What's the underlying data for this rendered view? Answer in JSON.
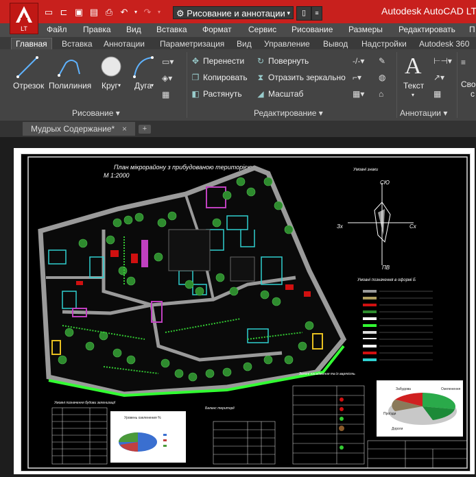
{
  "app": {
    "title": "Autodesk AutoCAD LT",
    "logo_letter": "A",
    "logo_sub": "LT",
    "workspace": "Рисование и аннотации"
  },
  "quick_access": [
    "new-icon",
    "open-icon",
    "save-icon",
    "saveas-icon",
    "print-icon",
    "undo-icon",
    "redo-icon"
  ],
  "menubar": {
    "items": [
      "Файл",
      "Правка",
      "Вид",
      "Вставка",
      "Формат",
      "Сервис",
      "Рисование",
      "Размеры",
      "Редактировать",
      "П"
    ]
  },
  "ribbon_tabs": {
    "items": [
      "Главная",
      "Вставка",
      "Аннотации",
      "Параметризация",
      "Вид",
      "Управление",
      "Вывод",
      "Надстройки",
      "Autodesk 360"
    ],
    "active": "Главная"
  },
  "ribbon": {
    "draw": {
      "line": "Отрезок",
      "polyline": "Полилиния",
      "circle": "Круг",
      "arc": "Дуга",
      "panel": "Рисование ▾"
    },
    "modify": {
      "move": "Перенести",
      "copy": "Копировать",
      "stretch": "Растянуть",
      "rotate": "Повернуть",
      "mirror": "Отразить зеркально",
      "scale": "Масштаб",
      "panel": "Редактирование ▾"
    },
    "annotation": {
      "text": "Текст",
      "big_letter": "A",
      "panel": "Аннотации ▾",
      "cut1": "Сво",
      "cut2": "с"
    }
  },
  "file_tab": {
    "name": "Мудрых Содержание*",
    "close": "×",
    "add": "+"
  },
  "drawing": {
    "title_line1": "План мікрорайону з прибудованою територією",
    "title_line2": "М 1:2000",
    "compass_top": "СЮ",
    "compass_bottom": "ПВ",
    "compass_left": "Зх",
    "compass_right": "Сх",
    "legend_title": "Умовні позначення в оформі Б",
    "table1_title": "Умовні позначення будови зеленизації",
    "table2_title": "Баланс території",
    "table3_title": "Зелені насадження та їх вартість",
    "chart1_title": "Уровень озеленения %",
    "pie_labels": [
      "Забудова",
      "Озеленення",
      "Проїзди",
      "Дороги"
    ]
  },
  "colors": {
    "titlebar": "#c8201d",
    "ribbon": "#444444",
    "paper_bg": "#000000",
    "road": "#9a9a9a",
    "tree": "#2e8b2e",
    "lime": "#33ff33",
    "cyan": "#2fd0d0",
    "magenta": "#c040c0",
    "red": "#d01010"
  }
}
